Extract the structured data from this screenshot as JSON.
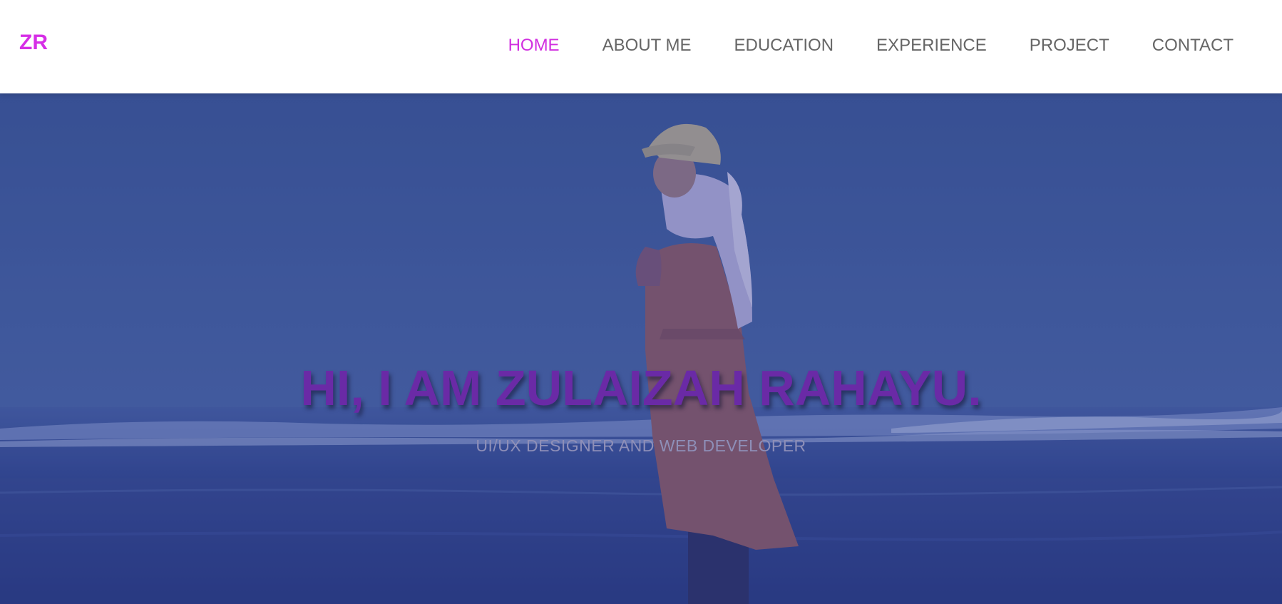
{
  "navbar": {
    "logo": "ZR",
    "items": [
      {
        "label": "HOME",
        "active": true
      },
      {
        "label": "ABOUT ME",
        "active": false
      },
      {
        "label": "EDUCATION",
        "active": false
      },
      {
        "label": "EXPERIENCE",
        "active": false
      },
      {
        "label": "PROJECT",
        "active": false
      },
      {
        "label": "CONTACT",
        "active": false
      }
    ]
  },
  "hero": {
    "title": "HI, I AM ZULAIZAH RAHAYU.",
    "subtitle": "UI/UX DESIGNER AND WEB DEVELOPER"
  },
  "colors": {
    "accent": "#d12fe0",
    "nav_text": "#666666",
    "title": "#6a2aa6",
    "overlay": "#3a5690"
  }
}
